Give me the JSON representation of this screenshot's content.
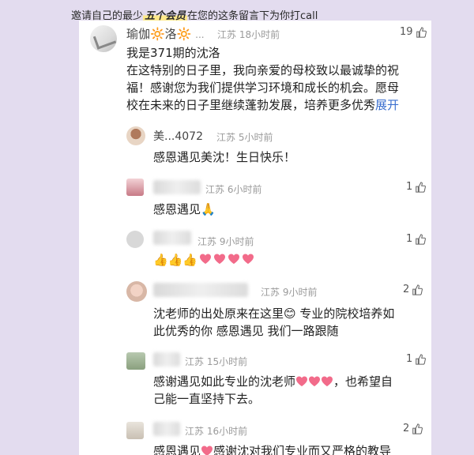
{
  "banner": {
    "prefix": "邀请自己的最少",
    "highlight": "五个会员",
    "suffix": "在您的这条留言下为你打call"
  },
  "main_comment": {
    "name": "瑜伽🔆洛🔆",
    "dots": "...",
    "meta": "江苏 18小时前",
    "likes": "19",
    "lines": [
      "我是371期的沈洛",
      "在这特别的日子里，我向亲爱的母校致以最诚挚的祝",
      "福！感谢您为我们提供学习环境和成长的机会。愿母",
      "校在未来的日子里继续蓬勃发展，培养更多优秀"
    ],
    "expand": "展开"
  },
  "replies": [
    {
      "name": "美...4072",
      "meta": "江苏 5小时前",
      "likes": "",
      "lines": [
        "感恩遇见美沈！生日快乐！"
      ]
    },
    {
      "name": "",
      "meta": "江苏 6小时前",
      "likes": "1",
      "lines": [
        "感恩遇见🙏"
      ]
    },
    {
      "name": "",
      "meta": "江苏 9小时前",
      "likes": "1",
      "lines": [
        ""
      ]
    },
    {
      "name": "",
      "meta": "江苏 9小时前",
      "likes": "2",
      "lines": [
        "沈老师的出处原来在这里😊 专业的院校培养如",
        "此优秀的你   感恩遇见  我们一路跟随"
      ]
    },
    {
      "name": "",
      "meta": "江苏 15小时前",
      "likes": "1",
      "lines": [
        "感谢遇见如此专业的沈老师",
        "，也希望自",
        "己能一直坚持下去。"
      ]
    },
    {
      "name": "",
      "meta": "江苏 16小时前",
      "likes": "2",
      "lines": [
        "感恩遇见",
        "感谢沈对我们专业而又严格的教导"
      ]
    }
  ],
  "colors": {
    "background": "#e3dcef",
    "card": "#ffffff",
    "link": "#3b6fcf",
    "heart": "#f26b8a"
  },
  "icons": [
    "thumb-up-icon",
    "heart-icon",
    "thumbs-emoji-icon",
    "pray-emoji-icon",
    "smile-emoji-icon"
  ]
}
